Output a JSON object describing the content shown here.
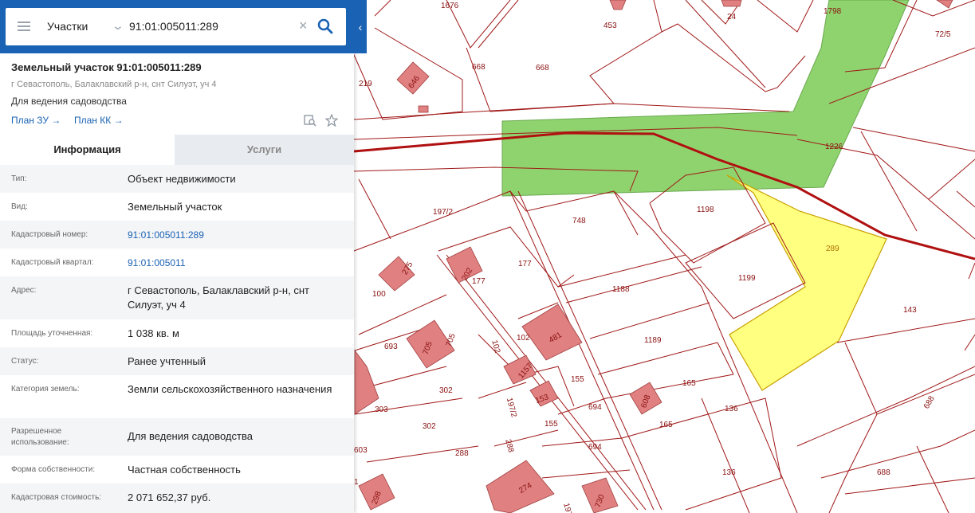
{
  "search": {
    "layer": "Участки",
    "query": "91:01:005011:289"
  },
  "parcel": {
    "title": "Земельный участок 91:01:005011:289",
    "address": "г Севастополь, Балаклавский р-н, снт Силуэт, уч 4",
    "purpose": "Для ведения садоводства",
    "links": [
      "План ЗУ →",
      "План КК →"
    ]
  },
  "tabs": [
    "Информация",
    "Услуги"
  ],
  "info_rows": [
    {
      "label": "Тип:",
      "value": "Объект недвижимости"
    },
    {
      "label": "Вид:",
      "value": "Земельный участок"
    },
    {
      "label": "Кадастровый номер:",
      "value": "91:01:005011:289"
    },
    {
      "label": "Кадастровый квартал:",
      "value": "91:01:005011"
    },
    {
      "label": "Адрес:",
      "value": "г Севастополь, Балаклавский р-н, снт Силуэт, уч 4"
    },
    {
      "label": "Площадь уточненная:",
      "value": "1 038 кв. м"
    },
    {
      "label": "Статус:",
      "value": "Ранее учтенный"
    },
    {
      "label": "Категория земель:",
      "value": "Земли сельскохозяйственного назначения"
    },
    {
      "label": "Разрешенное использование:",
      "value": "Для ведения садоводства"
    },
    {
      "label": "Форма собственности:",
      "value": "Частная собственность"
    },
    {
      "label": "Кадастровая стоимость:",
      "value": "2 071 652,37 руб."
    }
  ],
  "map_labels": [
    "1676",
    "453",
    "24",
    "1798",
    "72/5",
    "668",
    "668",
    "219",
    "646",
    "1226",
    "197/2",
    "748",
    "1198",
    "289",
    "100",
    "275",
    "202",
    "177",
    "177",
    "1199",
    "143",
    "1188",
    "693",
    "705",
    "705",
    "102",
    "481",
    "102",
    "1189",
    "1157",
    "155",
    "302",
    "197/2",
    "153",
    "608",
    "165",
    "303",
    "302",
    "155",
    "694",
    "165",
    "136",
    "688",
    "288",
    "288",
    "694",
    "136",
    "688",
    "298",
    "274",
    "730",
    "197",
    "603",
    "1"
  ],
  "colors": {
    "header": "#1a62b4",
    "selected_parcel": "#ffff80",
    "green_zone": "#8fd36e",
    "building": "#e08080",
    "boundary": "#a01818"
  }
}
